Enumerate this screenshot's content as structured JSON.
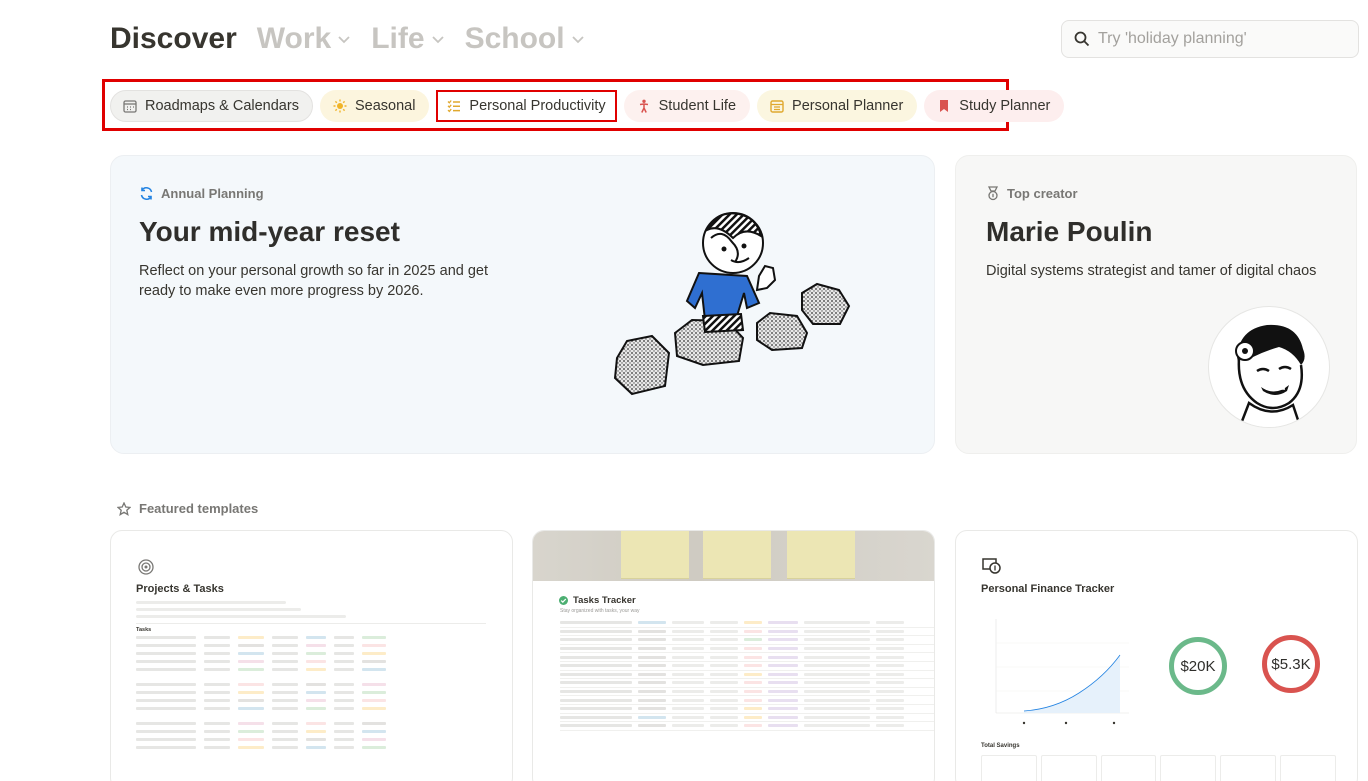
{
  "nav": {
    "tabs": [
      {
        "label": "Discover",
        "active": true
      },
      {
        "label": "Work",
        "active": false
      },
      {
        "label": "Life",
        "active": false
      },
      {
        "label": "School",
        "active": false
      }
    ]
  },
  "search": {
    "placeholder": "Try 'holiday planning'"
  },
  "categories": [
    {
      "label": "Roadmaps & Calendars",
      "icon": "calendar-icon"
    },
    {
      "label": "Seasonal",
      "icon": "sun-icon"
    },
    {
      "label": "Personal Productivity",
      "icon": "checklist-icon"
    },
    {
      "label": "Student Life",
      "icon": "person-icon"
    },
    {
      "label": "Personal Planner",
      "icon": "planner-icon"
    },
    {
      "label": "Study Planner",
      "icon": "bookmark-icon"
    }
  ],
  "hero": {
    "eyebrow": "Annual Planning",
    "title": "Your mid-year reset",
    "description": "Reflect on your personal growth so far in 2025 and get ready to make even more progress by 2026."
  },
  "creator": {
    "eyebrow": "Top creator",
    "name": "Marie Poulin",
    "description": "Digital systems strategist and tamer of digital chaos"
  },
  "featured": {
    "label": "Featured templates",
    "cards": [
      {
        "title": "Projects & Tasks",
        "section": "Tasks"
      },
      {
        "title": "Tasks Tracker",
        "subtitle": "Stay organized with tasks, your way"
      },
      {
        "title": "Personal Finance Tracker",
        "stat1": "$20K",
        "stat2": "$5.3K",
        "section": "Total Savings"
      }
    ]
  },
  "colors": {
    "highlight": "#e00000",
    "accent_blue": "#2383e2"
  }
}
